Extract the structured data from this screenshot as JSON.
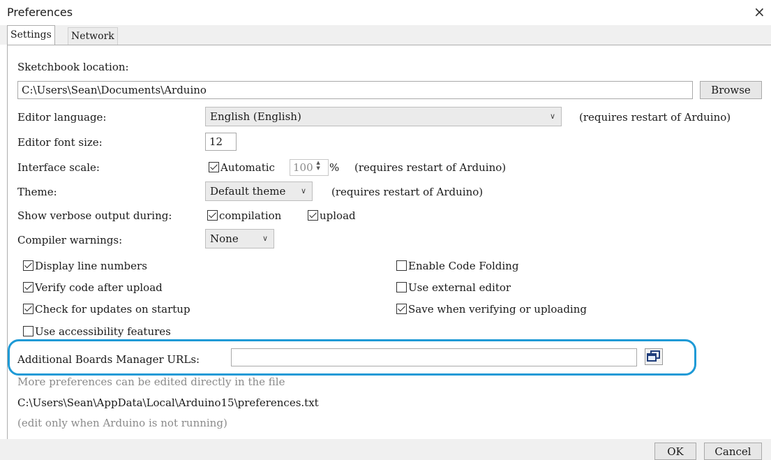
{
  "window": {
    "title": "Preferences",
    "close_icon": "×"
  },
  "tabs": [
    {
      "label": "Settings"
    },
    {
      "label": "Network"
    }
  ],
  "sketchbook": {
    "label": "Sketchbook location:",
    "value": "C:\\Users\\Sean\\Documents\\Arduino",
    "browse_label": "Browse"
  },
  "editor_language": {
    "label": "Editor language:",
    "value": "English (English)",
    "note": "(requires restart of Arduino)"
  },
  "font_size": {
    "label": "Editor font size:",
    "value": "12"
  },
  "interface_scale": {
    "label": "Interface scale:",
    "automatic_label": "Automatic",
    "automatic_checked": true,
    "value": "100",
    "unit": "%",
    "note": "(requires restart of Arduino)"
  },
  "theme": {
    "label": "Theme:",
    "value": "Default theme",
    "note": "(requires restart of Arduino)"
  },
  "verbose": {
    "label": "Show verbose output during:",
    "compilation_label": "compilation",
    "compilation_checked": true,
    "upload_label": "upload",
    "upload_checked": true
  },
  "compiler_warnings": {
    "label": "Compiler warnings:",
    "value": "None"
  },
  "options": {
    "display_line_numbers": {
      "label": "Display line numbers",
      "checked": true
    },
    "verify_after_upload": {
      "label": "Verify code after upload",
      "checked": true
    },
    "check_updates": {
      "label": "Check for updates on startup",
      "checked": true
    },
    "accessibility": {
      "label": "Use accessibility features",
      "checked": false
    },
    "code_folding": {
      "label": "Enable Code Folding",
      "checked": false
    },
    "external_editor": {
      "label": "Use external editor",
      "checked": false
    },
    "save_when_verifying": {
      "label": "Save when verifying or uploading",
      "checked": true
    }
  },
  "boards_urls": {
    "label": "Additional Boards Manager URLs:",
    "value": "",
    "button_icon": "window-icon"
  },
  "info": {
    "more_prefs": "More preferences can be edited directly in the file",
    "path": "C:\\Users\\Sean\\AppData\\Local\\Arduino15\\preferences.txt",
    "edit_note": "(edit only when Arduino is not running)"
  },
  "buttons": {
    "ok": "OK",
    "cancel": "Cancel"
  },
  "colors": {
    "highlight": "#1e9ad6"
  }
}
